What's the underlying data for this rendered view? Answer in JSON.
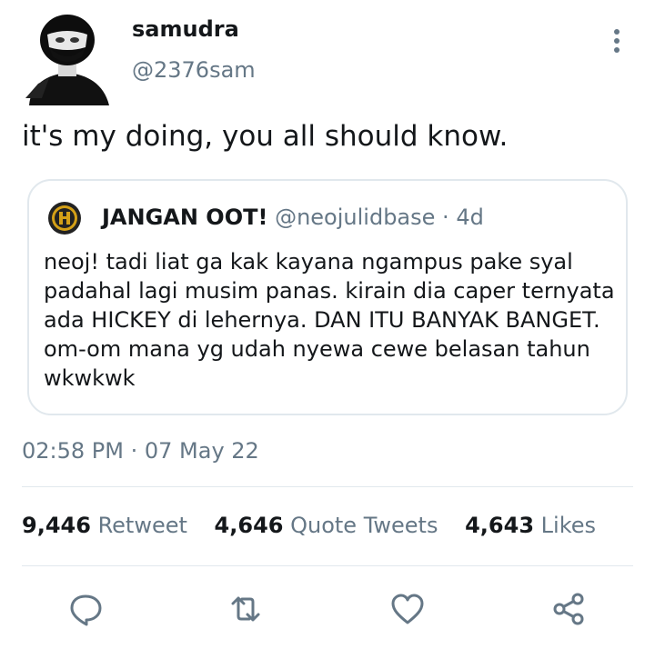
{
  "tweet": {
    "display_name": "samudra",
    "handle": "@2376sam",
    "text": "it's my doing, you all should know.",
    "timestamp": "02:58 PM · 07 May 22"
  },
  "quote": {
    "name": "JANGAN OOT!",
    "handle": "@neojulidbase",
    "separator": "·",
    "time": "4d",
    "text": "neoj! tadi liat ga kak kayana ngampus pake syal padahal lagi musim panas. kirain dia caper ternyata ada HICKEY di lehernya. DAN ITU BANYAK BANGET. om-om mana yg udah nyewa cewe belasan tahun wkwkwk"
  },
  "stats": {
    "retweets_count": "9,446",
    "retweets_label": "Retweet",
    "quotes_count": "4,646",
    "quotes_label": "Quote Tweets",
    "likes_count": "4,643",
    "likes_label": "Likes"
  },
  "actions": [
    "reply-icon",
    "retweet-icon",
    "like-icon",
    "share-icon"
  ],
  "colors": {
    "text": "#14171a",
    "secondary": "#657786",
    "border": "#e1e8ed"
  }
}
